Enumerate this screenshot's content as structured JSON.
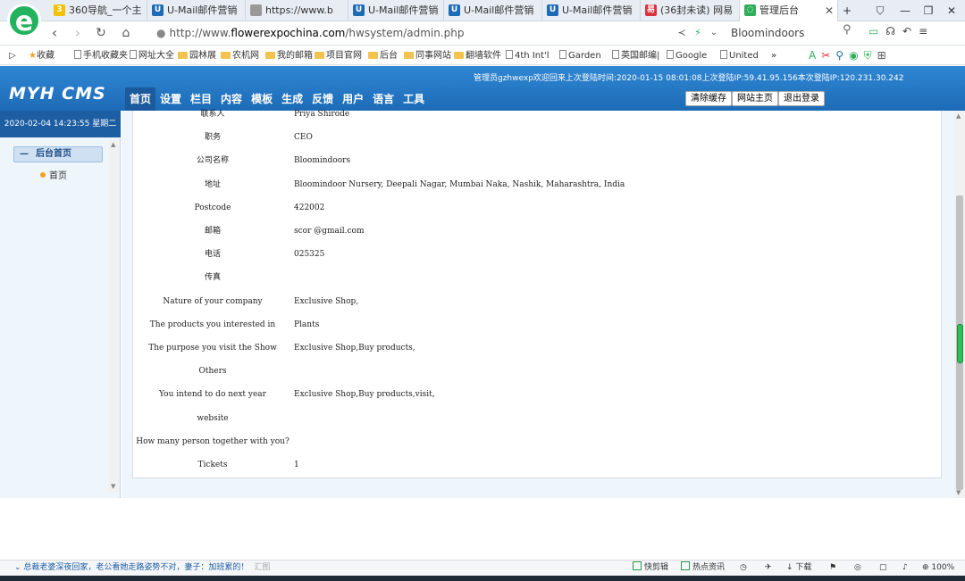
{
  "browser": {
    "tabs": [
      {
        "label": "360导航_一个主",
        "icon": "360-icon",
        "color": "#f2c200",
        "glyph": "3"
      },
      {
        "label": "U-Mail邮件营销",
        "icon": "umail-icon",
        "color": "#1d6bb7",
        "glyph": "U"
      },
      {
        "label": "https://www.b",
        "icon": "page-icon",
        "color": "#999999",
        "glyph": ""
      },
      {
        "label": "U-Mail邮件营销",
        "icon": "umail-icon",
        "color": "#1d6bb7",
        "glyph": "U"
      },
      {
        "label": "U-Mail邮件营销",
        "icon": "umail-icon",
        "color": "#1d6bb7",
        "glyph": "U"
      },
      {
        "label": "U-Mail邮件营销",
        "icon": "umail-icon",
        "color": "#1d6bb7",
        "glyph": "U"
      },
      {
        "label": "(36封未读) 网易",
        "icon": "netease-icon",
        "color": "#d9333f",
        "glyph": "易"
      },
      {
        "label": "管理后台",
        "icon": "loading-icon",
        "color": "#2fae5b",
        "glyph": "◌"
      }
    ],
    "new_tab": "+",
    "url_prefix": "http://www.",
    "url_domain": "flowerexpochina.com",
    "url_path": "/hwsystem/admin.php",
    "search_query": "Bloomindoors",
    "bookmarks": [
      {
        "label": "收藏",
        "type": "star"
      },
      {
        "label": "手机收藏夹",
        "type": "page"
      },
      {
        "label": "网址大全",
        "type": "page"
      },
      {
        "label": "园林展",
        "type": "folder"
      },
      {
        "label": "农机网",
        "type": "folder"
      },
      {
        "label": "我的邮箱",
        "type": "folder"
      },
      {
        "label": "项目官网",
        "type": "folder"
      },
      {
        "label": "后台",
        "type": "folder"
      },
      {
        "label": "同事网站",
        "type": "folder"
      },
      {
        "label": "翻墙软件",
        "type": "folder"
      },
      {
        "label": "4th Int'l",
        "type": "page"
      },
      {
        "label": "Garden",
        "type": "page"
      },
      {
        "label": "英国邮编|",
        "type": "page"
      },
      {
        "label": "Google",
        "type": "page"
      },
      {
        "label": "United",
        "type": "page"
      },
      {
        "label": "»",
        "type": "more"
      }
    ]
  },
  "cms": {
    "logo": "MYH CMS",
    "login_info": "管理员gzhwexp欢迎回来上次登陆时间:2020-01-15 08:01:08上次登陆IP:59.41.95.156本次登陆IP:120.231.30.242",
    "menu": [
      "首页",
      "设置",
      "栏目",
      "内容",
      "模板",
      "生成",
      "反馈",
      "用户",
      "语言",
      "工具"
    ],
    "buttons": {
      "clear_cache": "清除缓存",
      "site_home": "网站主页",
      "logout": "退出登录"
    },
    "date": "2020-02-04 14:23:55 星期二",
    "sidebar_group": "后台首页",
    "sidebar_group_toggle": "—",
    "sidebar_item": "首页"
  },
  "form_rows": [
    {
      "label": "联系人",
      "value": "Priya Shirode"
    },
    {
      "label": "职务",
      "value": "CEO"
    },
    {
      "label": "公司名称",
      "value": "Bloomindoors"
    },
    {
      "label": "地址",
      "value": "Bloomindoor Nursery, Deepali Nagar, Mumbai Naka, Nashik, Maharashtra, India"
    },
    {
      "label": "Postcode",
      "value": "422002"
    },
    {
      "label": "邮箱",
      "value": "scor        @gmail.com"
    },
    {
      "label": "电话",
      "value": "025325"
    },
    {
      "label": "传真",
      "value": ""
    },
    {
      "label": "Nature of your company",
      "value": "Exclusive Shop,"
    },
    {
      "label": "The products you interested in",
      "value": "Plants"
    },
    {
      "label": "The purpose you visit the Show",
      "value": "Exclusive Shop,Buy products,"
    },
    {
      "label": "Others",
      "value": ""
    },
    {
      "label": "You intend to do next year",
      "value": "Exclusive Shop,Buy products,visit,"
    },
    {
      "label": "website",
      "value": ""
    },
    {
      "label": "How many person together with you?",
      "value": ""
    },
    {
      "label": "Tickets",
      "value": "1"
    }
  ],
  "status": {
    "news": "总裁老婆深夜回家，老公看她走路姿势不对，妻子：加班累的！",
    "news_extra": "汇图",
    "items": [
      "快剪辑",
      "热点资讯",
      "下载",
      "100%"
    ]
  }
}
